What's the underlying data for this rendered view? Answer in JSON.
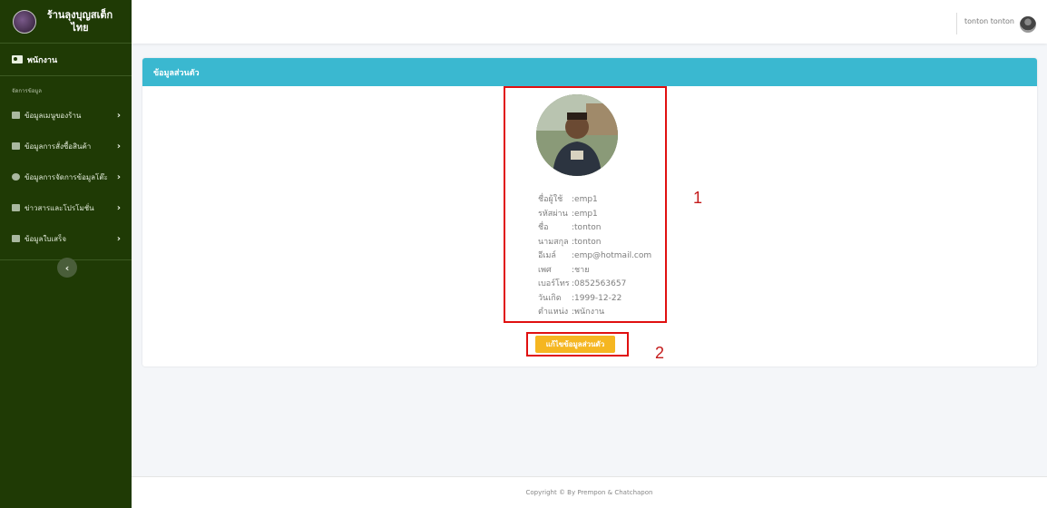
{
  "brand": {
    "title": "ร้านลุงบุญสเต็ก ไทย"
  },
  "sidebar": {
    "user_label": "พนักงาน",
    "section_label": "จัดการข้อมูล",
    "items": [
      {
        "label": "ข้อมูลเมนูของร้าน",
        "icon": "table-icon"
      },
      {
        "label": "ข้อมูลการสั่งซื้อสินค้า",
        "icon": "cart-icon"
      },
      {
        "label": "ข้อมูลการจัดการข้อมูลโต๊ะ",
        "icon": "database-icon"
      },
      {
        "label": "ข่าวสารและโปรโมชั่น",
        "icon": "megaphone-icon"
      },
      {
        "label": "ข้อมูลใบเสร็จ",
        "icon": "receipt-icon"
      }
    ],
    "collapse_icon": "chevron-left-icon"
  },
  "topbar": {
    "username": "tonton tonton"
  },
  "card": {
    "title": "ข้อมูลส่วนตัว",
    "profile": [
      {
        "label": "ชื่อผู้ใช้",
        "value": ":emp1"
      },
      {
        "label": "รหัสผ่าน",
        "value": ":emp1"
      },
      {
        "label": "ชื่อ",
        "value": ":tonton"
      },
      {
        "label": "นามสกุล",
        "value": ":tonton"
      },
      {
        "label": "อีเมล์",
        "value": ":emp@hotmail.com"
      },
      {
        "label": "เพศ",
        "value": ":ชาย"
      },
      {
        "label": "เบอร์โทร",
        "value": ":0852563657"
      },
      {
        "label": "วันเกิด",
        "value": ":1999-12-22"
      },
      {
        "label": "ตำแหน่ง",
        "value": ":พนักงาน"
      }
    ],
    "edit_button": "แก้ไขข้อมูลส่วนตัว"
  },
  "annotations": {
    "one": "1",
    "two": "2"
  },
  "footer": {
    "copyright": "Copyright © By Prempon & Chatchapon"
  },
  "colors": {
    "sidebar": "#1f3a05",
    "header": "#3ab8d0",
    "button": "#f5b621",
    "annotation": "#e01010"
  }
}
